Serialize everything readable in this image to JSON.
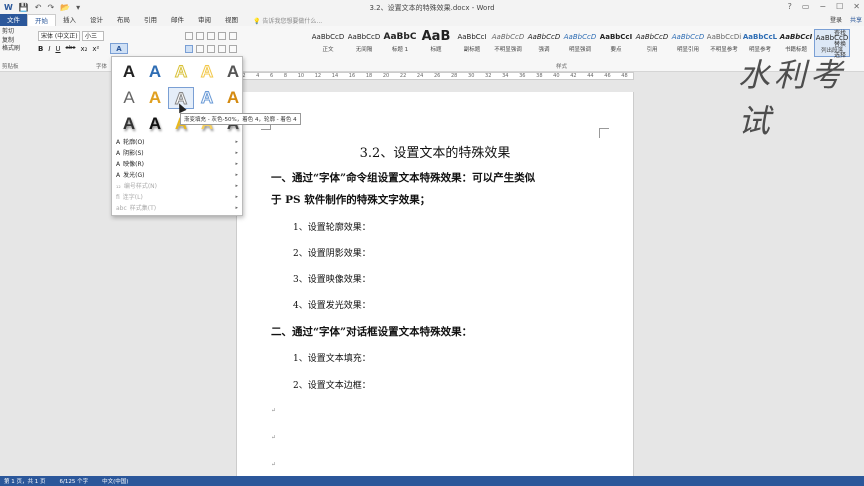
{
  "titlebar": {
    "title": "3.2、设置文本的特殊效果.docx - Word",
    "qat": [
      "W",
      "💾",
      "↶",
      "↷",
      "📂",
      "▾"
    ]
  },
  "window_controls": [
    "?",
    "▭",
    "−",
    "☐",
    "✕"
  ],
  "tabs": [
    "文件",
    "开始",
    "插入",
    "设计",
    "布局",
    "引用",
    "邮件",
    "审阅",
    "视图"
  ],
  "active_tab": "开始",
  "tellme": "告诉我您想要做什么...",
  "signin": "登录",
  "share": "共享",
  "clipboard": {
    "items": [
      "剪切",
      "复制",
      "格式刷"
    ],
    "label": "剪贴板"
  },
  "font": {
    "name": "宋体 (中文正)",
    "size": "小三",
    "label": "字体",
    "buttons": [
      "B",
      "I",
      "U",
      "abc",
      "x₂",
      "x²"
    ],
    "effect_btn": "A"
  },
  "styles": {
    "label": "样式",
    "items": [
      {
        "preview": "AaBbCcD",
        "name": "正文"
      },
      {
        "preview": "AaBbCcD",
        "name": "无间隔"
      },
      {
        "preview": "AaBbC",
        "name": "标题 1"
      },
      {
        "preview": "AaB",
        "name": "标题"
      },
      {
        "preview": "AaBbCcI",
        "name": "副标题"
      },
      {
        "preview": "AaBbCcD",
        "name": "不明显强调"
      },
      {
        "preview": "AaBbCcD",
        "name": "强调"
      },
      {
        "preview": "AaBbCcD",
        "name": "明显强调"
      },
      {
        "preview": "AaBbCcI",
        "name": "要点"
      },
      {
        "preview": "AaBbCcD",
        "name": "引用"
      },
      {
        "preview": "AaBbCcD",
        "name": "明显引用"
      },
      {
        "preview": "AaBbCcDi",
        "name": "不明显参考"
      },
      {
        "preview": "AaBbCcL",
        "name": "明显参考"
      },
      {
        "preview": "AaBbCcI",
        "name": "书籍标题"
      },
      {
        "preview": "AaBbCcD",
        "name": "列出段落"
      }
    ]
  },
  "editing": [
    "查找",
    "替换",
    "选择"
  ],
  "ruler_ticks": [
    "2",
    "4",
    "6",
    "8",
    "10",
    "12",
    "14",
    "16",
    "18",
    "20",
    "22",
    "24",
    "26",
    "28",
    "30",
    "32",
    "34",
    "36",
    "38",
    "40",
    "42",
    "44",
    "46",
    "48"
  ],
  "gallery": {
    "glyph": "A",
    "cells": [
      {
        "color": "#222222",
        "style": "solid"
      },
      {
        "color": "#2e6db4",
        "style": "solid"
      },
      {
        "color": "#d9c23a",
        "style": "outline"
      },
      {
        "color": "#f2c84b",
        "style": "outline"
      },
      {
        "color": "#555555",
        "style": "solid"
      },
      {
        "color": "#666666",
        "style": "light"
      },
      {
        "color": "#e0a020",
        "style": "solid"
      },
      {
        "color": "#888888",
        "style": "outline-highlight"
      },
      {
        "color": "#6a9ad6",
        "style": "outline"
      },
      {
        "color": "#d48a10",
        "style": "solid"
      },
      {
        "color": "#333333",
        "style": "shadow"
      },
      {
        "color": "#111111",
        "style": "shadow"
      },
      {
        "color": "#e8b820",
        "style": "shadow"
      },
      {
        "color": "#f5d060",
        "style": "shadow"
      },
      {
        "color": "#444444",
        "style": "shadow"
      }
    ],
    "menu": [
      {
        "icon": "A",
        "label": "轮廓(O)",
        "disabled": false
      },
      {
        "icon": "A",
        "label": "阴影(S)",
        "disabled": false
      },
      {
        "icon": "A",
        "label": "映像(R)",
        "disabled": false
      },
      {
        "icon": "A",
        "label": "发光(G)",
        "disabled": false
      },
      {
        "icon": "₁₂",
        "label": "编号样式(N)",
        "disabled": true
      },
      {
        "icon": "fi",
        "label": "连字(L)",
        "disabled": true
      },
      {
        "icon": "abc",
        "label": "样式集(T)",
        "disabled": true
      }
    ],
    "tooltip": "渐变填充 - 灰色-50%，着色 4，轮廓 - 着色 4"
  },
  "document": {
    "title": "3.2、设置文本的特殊效果",
    "h1_line1": "一、通过“字体”命令组设置文本特殊效果：可以产生类似",
    "h1_line2": "于 PS 软件制作的特殊文字效果；",
    "items1": [
      "1、设置轮廓效果：",
      "2、设置阴影效果：",
      "3、设置映像效果：",
      "4、设置发光效果："
    ],
    "h2": "二、通过“字体”对话框设置文本特殊效果：",
    "items2": [
      "1、设置文本填充：",
      "2、设置文本边框："
    ],
    "para_mark": "↵"
  },
  "watermark": "水利考试",
  "status": [
    "第 1 页，共 1 页",
    "6/125 个字",
    "中文(中国)"
  ]
}
